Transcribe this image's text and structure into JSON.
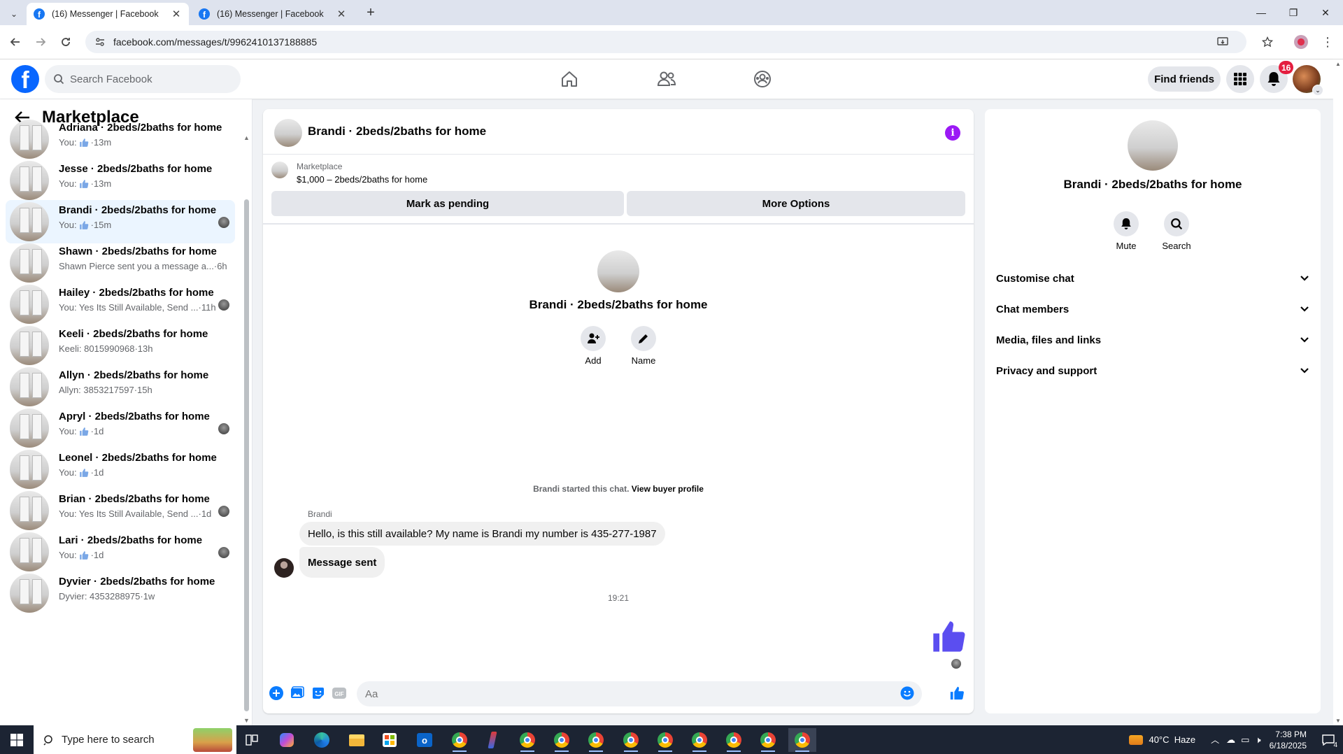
{
  "browser": {
    "tabs": [
      {
        "title": "(16) Messenger | Facebook",
        "close": "✕"
      },
      {
        "title": "(16) Messenger | Facebook",
        "close": "✕"
      }
    ],
    "new_tab": "+",
    "url": "facebook.com/messages/t/9962410137188885"
  },
  "header": {
    "logo": "f",
    "search_placeholder": "Search Facebook",
    "find_friends": "Find friends",
    "notifications_count": "16"
  },
  "left_panel": {
    "title": "Marketplace",
    "conversations": [
      {
        "name": "Adriana · 2beds/2baths for home",
        "prefix": "You:",
        "like": true,
        "snippet": "",
        "time": "13m",
        "seen": false,
        "selected": false
      },
      {
        "name": "Jesse · 2beds/2baths for home",
        "prefix": "You:",
        "like": true,
        "snippet": "",
        "time": "13m",
        "seen": false,
        "selected": false
      },
      {
        "name": "Brandi · 2beds/2baths for home",
        "prefix": "You:",
        "like": true,
        "snippet": "",
        "time": "15m",
        "seen": true,
        "selected": true
      },
      {
        "name": "Shawn · 2beds/2baths for home",
        "prefix": "",
        "like": false,
        "snippet": "Shawn Pierce sent you a message a...",
        "time": "6h",
        "seen": false,
        "selected": false
      },
      {
        "name": "Hailey · 2beds/2baths for home",
        "prefix": "",
        "like": false,
        "snippet": "You: Yes Its Still Available, Send ...",
        "time": "11h",
        "seen": true,
        "selected": false
      },
      {
        "name": "Keeli · 2beds/2baths for home",
        "prefix": "",
        "like": false,
        "snippet": "Keeli: 8015990968",
        "time": "13h",
        "seen": false,
        "selected": false
      },
      {
        "name": "Allyn · 2beds/2baths for home",
        "prefix": "",
        "like": false,
        "snippet": "Allyn: 3853217597",
        "time": "15h",
        "seen": false,
        "selected": false
      },
      {
        "name": "Apryl · 2beds/2baths for home",
        "prefix": "You:",
        "like": true,
        "snippet": "",
        "time": "1d",
        "seen": true,
        "selected": false
      },
      {
        "name": "Leonel · 2beds/2baths for home",
        "prefix": "You:",
        "like": true,
        "snippet": "",
        "time": "1d",
        "seen": false,
        "selected": false
      },
      {
        "name": "Brian · 2beds/2baths for home",
        "prefix": "",
        "like": false,
        "snippet": "You: Yes Its Still Available, Send ...",
        "time": "1d",
        "seen": true,
        "selected": false
      },
      {
        "name": "Lari · 2beds/2baths for home",
        "prefix": "You:",
        "like": true,
        "snippet": "",
        "time": "1d",
        "seen": true,
        "selected": false
      },
      {
        "name": "Dyvier · 2beds/2baths for home",
        "prefix": "",
        "like": false,
        "snippet": "Dyvier: 4353288975",
        "time": "1w",
        "seen": false,
        "selected": false
      }
    ]
  },
  "chat": {
    "title": "Brandi · 2beds/2baths for home",
    "marketplace_label": "Marketplace",
    "item": "$1,000 – 2beds/2baths for home",
    "mark_pending": "Mark as pending",
    "more_options": "More Options",
    "profile_name": "Brandi · 2beds/2baths for home",
    "add_label": "Add",
    "name_label": "Name",
    "started_text": "Brandi started this chat.",
    "view_buyer_profile": "View buyer profile",
    "sender": "Brandi",
    "messages": [
      "Hello, is this still available? My name is Brandi my number is 435-277-1987",
      "Message sent"
    ],
    "timestamp": "19:21",
    "input_placeholder": "Aa"
  },
  "right_panel": {
    "name": "Brandi · 2beds/2baths for home",
    "mute": "Mute",
    "search": "Search",
    "sections": [
      "Customise chat",
      "Chat members",
      "Media, files and links",
      "Privacy and support"
    ]
  },
  "taskbar": {
    "search_placeholder": "Type here to search",
    "weather": "40°C  Haze",
    "time": "7:38 PM",
    "date": "6/18/2025",
    "notifications": "4"
  },
  "colors": {
    "fb_blue": "#0866ff",
    "messenger_blue": "#0a7cff",
    "like_purple": "#5b4ef0",
    "selected_bg": "#ebf5ff",
    "info_purple": "#9b19f5",
    "badge_red": "#e41e3f"
  }
}
